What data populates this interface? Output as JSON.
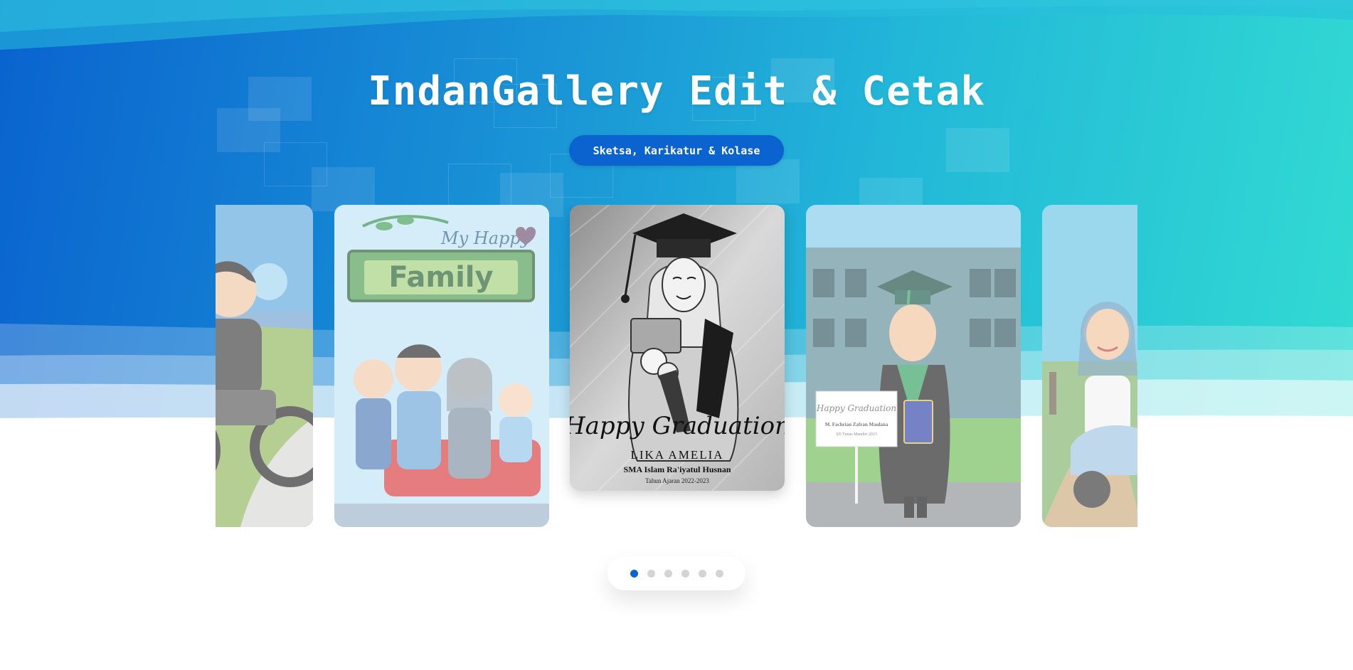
{
  "hero": {
    "title": "IndanGallery Edit & Cetak",
    "badge": "Sketsa, Karikatur & Kolase"
  },
  "colors": {
    "gradient_start": "#0a63cf",
    "gradient_end": "#32dbd2",
    "accent": "#0b63cf",
    "dot_inactive": "#d4d4d4"
  },
  "carousel": {
    "slides": [
      {
        "subject": "motorcycle caricature",
        "active": false
      },
      {
        "subject": "family caricature",
        "image_text": {
          "top": "My Happy",
          "banner": "Family"
        },
        "active": false
      },
      {
        "subject": "graduation sketch",
        "image_text": {
          "script": "Happy Graduation",
          "name": "LIKA AMELIA",
          "school": "SMA Islam Ra'iyatul Husnan",
          "year": "Tahun Ajaran 2022-2023"
        },
        "active": true
      },
      {
        "subject": "graduation caricature",
        "image_text": {
          "script": "Happy Graduation",
          "name": "M. Fachrian Zafran Maulana",
          "school": "SD Tunas Mandiri 2023"
        },
        "active": false
      },
      {
        "subject": "scooter caricature",
        "active": false
      }
    ],
    "dots": {
      "count": 6,
      "active_index": 0
    }
  }
}
